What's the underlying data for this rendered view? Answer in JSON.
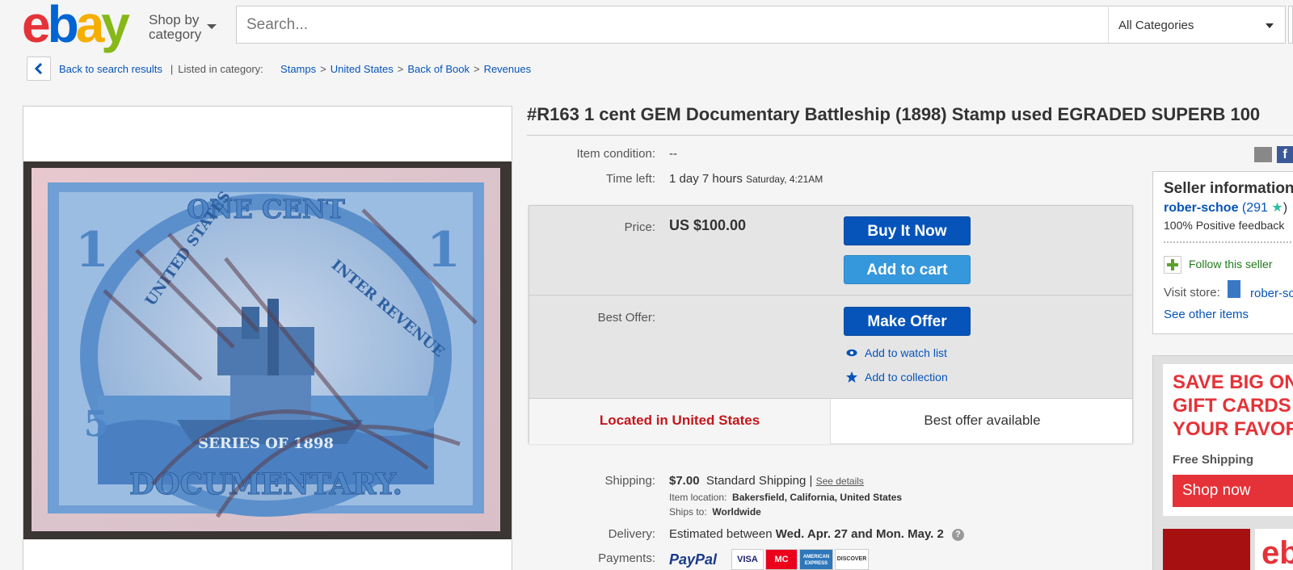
{
  "header": {
    "logo_letters": [
      "e",
      "b",
      "a",
      "y"
    ],
    "logo_colors": [
      "#e53238",
      "#0064d2",
      "#f5af02",
      "#86b817"
    ],
    "shop_by_line1": "Shop by",
    "shop_by_line2": "category",
    "search_placeholder": "Search...",
    "category_selected": "All Categories"
  },
  "breadcrumb": {
    "back_label": "Back to search results",
    "listed_in": "Listed in category:",
    "items": [
      "Stamps",
      "United States",
      "Back of Book",
      "Revenues"
    ]
  },
  "item": {
    "title": "#R163 1 cent GEM Documentary Battleship (1898) Stamp used EGRADED SUPERB 100",
    "condition_label": "Item condition:",
    "condition_value": "--",
    "time_left_label": "Time left:",
    "time_left_value": "1 day 7 hours",
    "time_left_end": "Saturday, 4:21AM"
  },
  "stamp_image": {
    "top_text": "ONE CENT",
    "arc_left": "UNITED STATES",
    "arc_right": "INTER REVENUE",
    "bottom_banner": "SERIES OF 1898",
    "bottom_text": "DOCUMENTARY.",
    "corner_value": "1",
    "corner_value_alt": "5"
  },
  "buy_box": {
    "price_label": "Price:",
    "price_value": "US $100.00",
    "buy_now": "Buy It Now",
    "add_to_cart": "Add to cart",
    "best_offer_label": "Best Offer:",
    "make_offer": "Make Offer",
    "watch_list": "Add to watch list",
    "collection": "Add to collection",
    "location": "Located in United States",
    "offer_available": "Best offer available"
  },
  "shipping": {
    "label": "Shipping:",
    "cost": "$7.00",
    "method": "Standard Shipping |",
    "details_link": "See details",
    "location_label": "Item location:",
    "location_value": "Bakersfield, California, United States",
    "ships_to_label": "Ships to:",
    "ships_to_value": "Worldwide",
    "delivery_label": "Delivery:",
    "delivery_prefix": "Estimated between",
    "delivery_dates": "Wed. Apr. 27 and Mon. May. 2",
    "help": "?",
    "payments_label": "Payments:",
    "paypal": "PayPal",
    "cards": [
      "VISA",
      "MC",
      "AMERICAN EXPRESS",
      "DISCOVER"
    ]
  },
  "share": {
    "fb": "f"
  },
  "seller": {
    "title": "Seller information",
    "name": "rober-schoe",
    "score_open": "(",
    "score": "291",
    "score_close": ")",
    "feedback": "100% Positive feedback",
    "follow": "Follow this seller",
    "visit_store": "Visit store:",
    "store_name": "rober-schoe",
    "see_other": "See other items"
  },
  "ad": {
    "headline": "SAVE BIG ON\nGIFT CARDS\nYOUR FAVOR",
    "free_shipping": "Free Shipping",
    "shop_now": "Shop now",
    "ebay_text": "eb"
  }
}
